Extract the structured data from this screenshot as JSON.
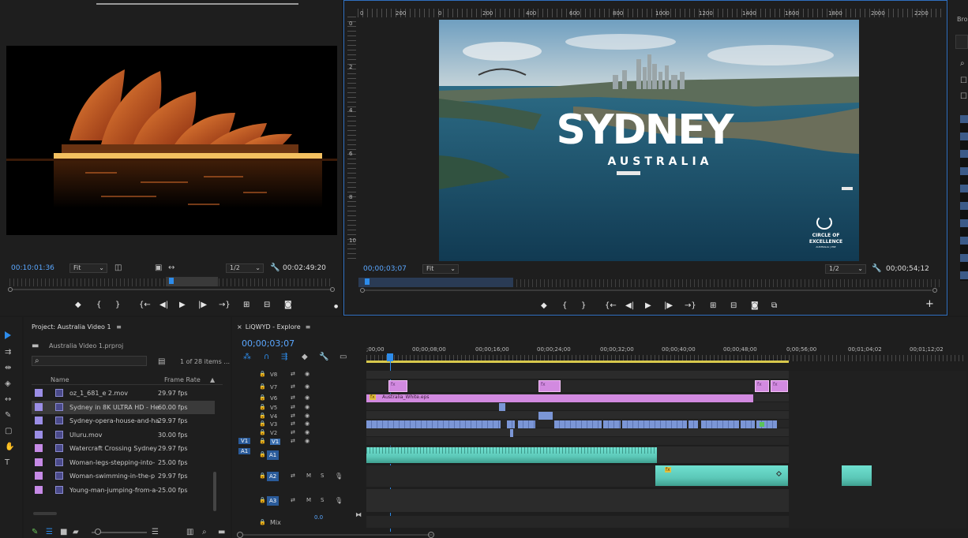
{
  "source_monitor": {
    "timecode_left": "00:10:01:36",
    "fit_label": "Fit",
    "resolution": "1/2",
    "timecode_right": "00:02:49:20"
  },
  "program_monitor": {
    "timecode_left": "00;00;03;07",
    "fit_label": "Fit",
    "resolution": "1/2",
    "timecode_right": "00;00;54;12",
    "video_title": "SYDNEY",
    "video_subtitle": "AUSTRALIA",
    "logo_line1": "CIRCLE OF",
    "logo_line2": "EXCELLENCE",
    "logo_line3": "AUSTRALIA | PSE",
    "ruler_labels": [
      "0",
      "200",
      "0",
      "200",
      "400",
      "600",
      "800",
      "1000",
      "1200",
      "1400",
      "1600",
      "1800",
      "2000",
      "2200"
    ],
    "vruler_labels": [
      "0",
      "2",
      "4",
      "6",
      "8",
      "10"
    ]
  },
  "browser_panel": {
    "label": "Bro"
  },
  "project": {
    "title": "Project: Australia Video 1",
    "menu": "≡",
    "file": "Australia Video 1.prproj",
    "items_count": "1 of 28 items ...",
    "col_name": "Name",
    "col_fps": "Frame Rate",
    "sort_arrow": "▲",
    "items": [
      {
        "name": "oz_1_681_e 2.mov",
        "fps": "29.97 fps",
        "color": "#9b8ee6",
        "selected": false
      },
      {
        "name": "Sydney in 8K ULTRA HD - He",
        "fps": "60.00 fps",
        "color": "#9b8ee6",
        "selected": true
      },
      {
        "name": "Sydney-opera-house-and-ha",
        "fps": "29.97 fps",
        "color": "#9b8ee6",
        "selected": false
      },
      {
        "name": "Uluru.mov",
        "fps": "30.00 fps",
        "color": "#9b8ee6",
        "selected": false
      },
      {
        "name": "Watercraft Crossing Sydney",
        "fps": "29.97 fps",
        "color": "#c68ae6",
        "selected": false
      },
      {
        "name": "Woman-legs-stepping-into-",
        "fps": "25.00 fps",
        "color": "#c68ae6",
        "selected": false
      },
      {
        "name": "Woman-swimming-in-the-p",
        "fps": "29.97 fps",
        "color": "#c68ae6",
        "selected": false
      },
      {
        "name": "Young-man-jumping-from-a-",
        "fps": "25.00 fps",
        "color": "#c68ae6",
        "selected": false
      }
    ]
  },
  "timeline": {
    "close": "×",
    "title": "LiQWYD - Explore",
    "menu": "≡",
    "timecode": "00;00;03;07",
    "ruler_labels": [
      ";00;00",
      "00;00;08;00",
      "00;00;16;00",
      "00;00;24;00",
      "00;00;32;00",
      "00;00;40;00",
      "00;00;48;00",
      "0;00;56;00",
      "00;01;04;02",
      "00;01;12;02"
    ],
    "video_tracks": [
      "V8",
      "V7",
      "V6",
      "V5",
      "V4",
      "V3",
      "V2",
      "V1"
    ],
    "audio_tracks": [
      "A1",
      "A2",
      "A3"
    ],
    "source_v": "V1",
    "source_a": "A1",
    "mix_label": "Mix",
    "mix_value": "0.0",
    "clip_label": "Australia_White.eps",
    "fx": "fx",
    "m": "M",
    "s": "S"
  }
}
